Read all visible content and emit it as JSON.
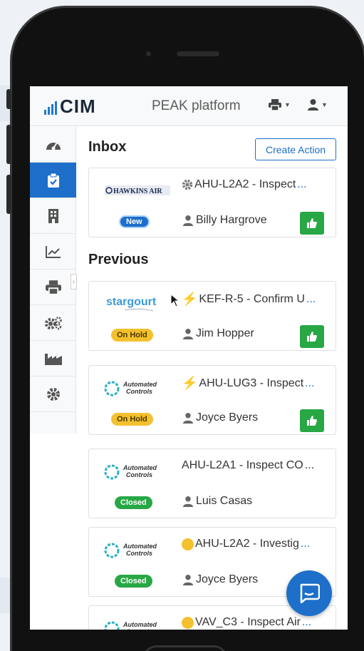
{
  "header": {
    "logo_text": "CIM",
    "platform_title": "PEAK platform",
    "print_icon": "printer-icon",
    "user_icon": "user-icon"
  },
  "sidebar": {
    "items": [
      {
        "icon": "dashboard-icon",
        "active": false
      },
      {
        "icon": "clipboard-check-icon",
        "active": true
      },
      {
        "icon": "building-icon",
        "active": false
      },
      {
        "icon": "chart-line-icon",
        "active": false
      },
      {
        "icon": "printer-icon",
        "active": false
      },
      {
        "icon": "cogs-icon",
        "active": false
      },
      {
        "icon": "industry-icon",
        "active": false
      },
      {
        "icon": "gear-icon",
        "active": false
      }
    ]
  },
  "inbox": {
    "title": "Inbox",
    "create_button": "Create Action",
    "cards": [
      {
        "logo": "HAWKINS AIR",
        "icon": "gear-icon",
        "title": "AHU-L2A2 - Inspect ",
        "ellipsis": "...",
        "status": "New",
        "assignee": "Billy Hargrove"
      }
    ]
  },
  "previous": {
    "title": "Previous",
    "cards": [
      {
        "logo": "stargourt",
        "icon": "lightning-icon",
        "title": "KEF-R-5 - Confirm U",
        "ellipsis": "...",
        "status": "On Hold",
        "assignee": "Jim Hopper"
      },
      {
        "logo": "Automated Controls",
        "icon": "lightning-icon",
        "title": "AHU-LUG3 - Inspect ",
        "ellipsis": "...",
        "status": "On Hold",
        "assignee": "Joyce Byers"
      },
      {
        "logo": "Automated Controls",
        "icon": "",
        "title": "AHU-L2A1 - Inspect CO",
        "ellipsis": "...",
        "status": "Closed",
        "assignee": "Luis Casas"
      },
      {
        "logo": "Automated Controls",
        "icon": "smiley-icon",
        "title": "AHU-L2A2 - Investig",
        "ellipsis": "...",
        "status": "Closed",
        "assignee": "Joyce Byers"
      },
      {
        "logo": "Automated Controls",
        "icon": "smiley-icon",
        "title": "VAV_C3 - Inspect Air ",
        "ellipsis": "...",
        "status": "",
        "assignee": ""
      }
    ]
  },
  "colors": {
    "primary": "#1d6fc9",
    "success": "#28a745",
    "warning": "#f5c02e"
  }
}
